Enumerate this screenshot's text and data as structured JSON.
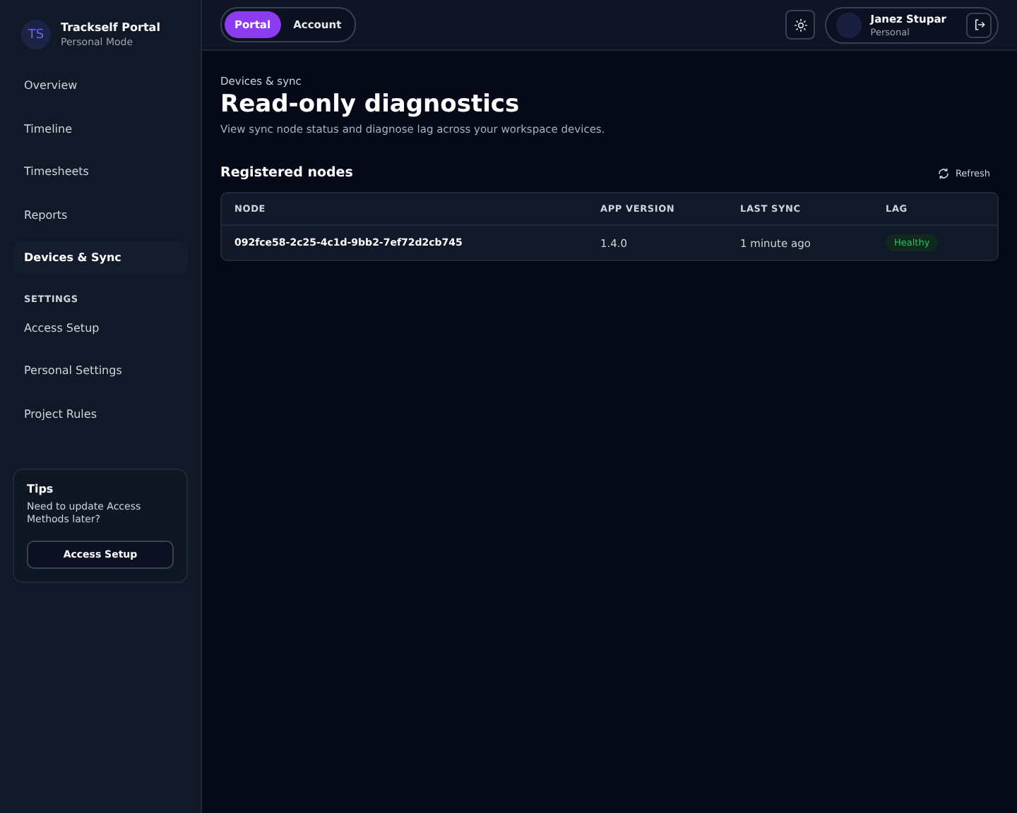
{
  "brand": {
    "initials": "TS",
    "name": "Trackself Portal",
    "mode": "Personal Mode"
  },
  "nav": [
    {
      "label": "Overview",
      "selected": false
    },
    {
      "label": "Timeline",
      "selected": false
    },
    {
      "label": "Timesheets",
      "selected": false
    },
    {
      "label": "Reports",
      "selected": false
    },
    {
      "label": "Devices & Sync",
      "selected": true
    }
  ],
  "settings": {
    "heading": "SETTINGS",
    "items": [
      {
        "label": "Access Setup",
        "selected": false
      },
      {
        "label": "Personal Settings",
        "selected": false
      },
      {
        "label": "Project Rules",
        "selected": false
      }
    ]
  },
  "tips": {
    "title": "Tips",
    "text": "Need to update Access Methods later?",
    "button": "Access Setup"
  },
  "topbar": {
    "tabs": [
      {
        "label": "Portal",
        "selected": true
      },
      {
        "label": "Account",
        "selected": false
      }
    ],
    "user": {
      "name": "Janez Stupar",
      "role": "Personal"
    }
  },
  "page": {
    "eyebrow": "Devices & sync",
    "title": "Read-only diagnostics",
    "subtitle": "View sync node status and diagnose lag across your workspace devices."
  },
  "nodes": {
    "title": "Registered nodes",
    "refresh": "Refresh",
    "columns": [
      "NODE",
      "APP VERSION",
      "LAST SYNC",
      "LAG"
    ],
    "rows": [
      {
        "node": "092fce58-2c25-4c1d-9bb2-7ef72d2cb745",
        "version": "1.4.0",
        "last_sync": "1 minute ago",
        "lag": "Healthy"
      }
    ]
  }
}
